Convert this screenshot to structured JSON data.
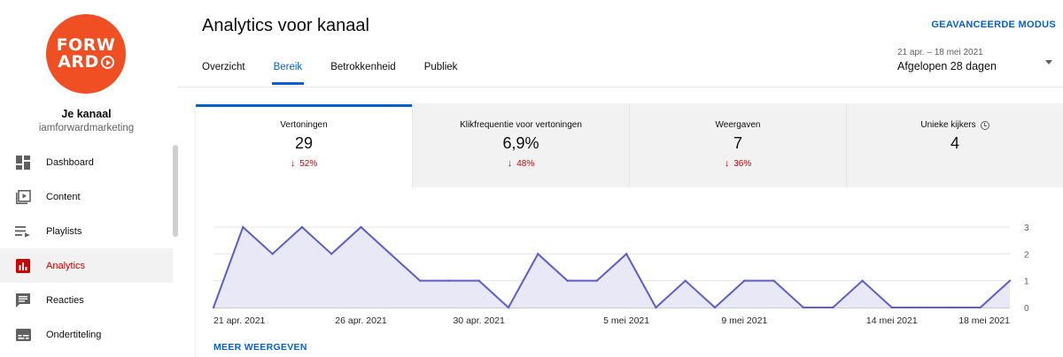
{
  "logo": {
    "line1": "FORW",
    "line2": "ARD"
  },
  "channel": {
    "title": "Je kanaal",
    "handle": "iamforwardmarketing"
  },
  "sidebar": {
    "items": [
      {
        "label": "Dashboard",
        "icon": "dashboard-icon",
        "active": false
      },
      {
        "label": "Content",
        "icon": "content-icon",
        "active": false
      },
      {
        "label": "Playlists",
        "icon": "playlists-icon",
        "active": false
      },
      {
        "label": "Analytics",
        "icon": "analytics-icon",
        "active": true
      },
      {
        "label": "Reacties",
        "icon": "comments-icon",
        "active": false
      },
      {
        "label": "Ondertiteling",
        "icon": "subtitles-icon",
        "active": false
      }
    ]
  },
  "header": {
    "title": "Analytics voor kanaal",
    "advanced_mode": "GEAVANCEERDE MODUS",
    "tabs": [
      "Overzicht",
      "Bereik",
      "Betrokkenheid",
      "Publiek"
    ],
    "active_tab": "Bereik",
    "date_range": "21 apr. – 18 mei 2021",
    "date_label": "Afgelopen 28 dagen"
  },
  "metrics": [
    {
      "title": "Vertoningen",
      "value": "29",
      "change": "52%"
    },
    {
      "title": "Klikfrequentie voor vertoningen",
      "value": "6,9%",
      "change": "48%"
    },
    {
      "title": "Weergaven",
      "value": "7",
      "change": "36%"
    },
    {
      "title": "Unieke kijkers",
      "value": "4",
      "change": ""
    }
  ],
  "chart_data": {
    "type": "area",
    "x_tick_labels": [
      "21 apr. 2021",
      "26 apr. 2021",
      "30 apr. 2021",
      "5 mei 2021",
      "9 mei 2021",
      "14 mei 2021",
      "18 mei 2021"
    ],
    "x_tick_index": [
      0,
      5,
      9,
      14,
      18,
      23,
      27
    ],
    "values": [
      0,
      3,
      2,
      3,
      2,
      3,
      2,
      1,
      1,
      1,
      0,
      2,
      1,
      1,
      2,
      0,
      1,
      0,
      1,
      1,
      0,
      0,
      1,
      0,
      0,
      0,
      0,
      1
    ],
    "y_ticks": [
      0,
      1,
      2,
      3
    ],
    "ylim": [
      0,
      3
    ],
    "line_color": "#5c5ccd",
    "fill_color": "#e8e8f7",
    "grid": true
  },
  "footer": {
    "show_more": "MEER WEERGEVEN"
  },
  "colors": {
    "accent": "#065fd4",
    "negative": "#cc0000",
    "brand": "#f04e23"
  }
}
